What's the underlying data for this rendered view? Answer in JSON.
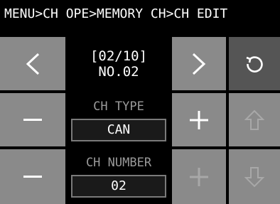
{
  "breadcrumb": "MENU>CH OPE>MEMORY CH>CH EDIT",
  "channel_info": {
    "page": "[02/10]",
    "name": "NO.02"
  },
  "ch_type": {
    "label": "CH TYPE",
    "value": "CAN"
  },
  "ch_number": {
    "label": "CH NUMBER",
    "value": "02"
  },
  "icons": {
    "prev": "chevron-left-icon",
    "next": "chevron-right-icon",
    "reset": "rotate-ccw-icon",
    "minus": "minus-icon",
    "plus": "plus-icon",
    "up": "arrow-up-icon",
    "down": "arrow-down-icon"
  },
  "colors": {
    "button": "#8a8a8a",
    "reset_button": "#555555",
    "disabled_icon": "#a8a8a8",
    "value_border": "#7a7a7a"
  }
}
